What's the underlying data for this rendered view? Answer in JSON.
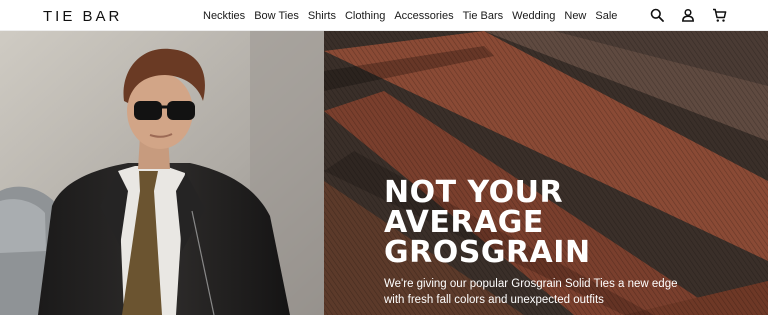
{
  "header": {
    "logo": "TIE BAR",
    "nav": [
      "Neckties",
      "Bow Ties",
      "Shirts",
      "Clothing",
      "Accessories",
      "Tie Bars",
      "Wedding",
      "New",
      "Sale"
    ],
    "icons": [
      "search-icon",
      "account-icon",
      "cart-icon"
    ]
  },
  "hero": {
    "headline": [
      "NOT YOUR",
      "AVERAGE",
      "GROSGRAIN"
    ],
    "subtext": [
      "We're giving our popular Grosgrain Solid Ties a new edge",
      "with fresh fall colors and unexpected outfits"
    ]
  },
  "colors": {
    "text": "#111111",
    "hero_text": "#ffffff",
    "fabric_brown": "#8a4a35",
    "fabric_dark": "#3a3530"
  }
}
